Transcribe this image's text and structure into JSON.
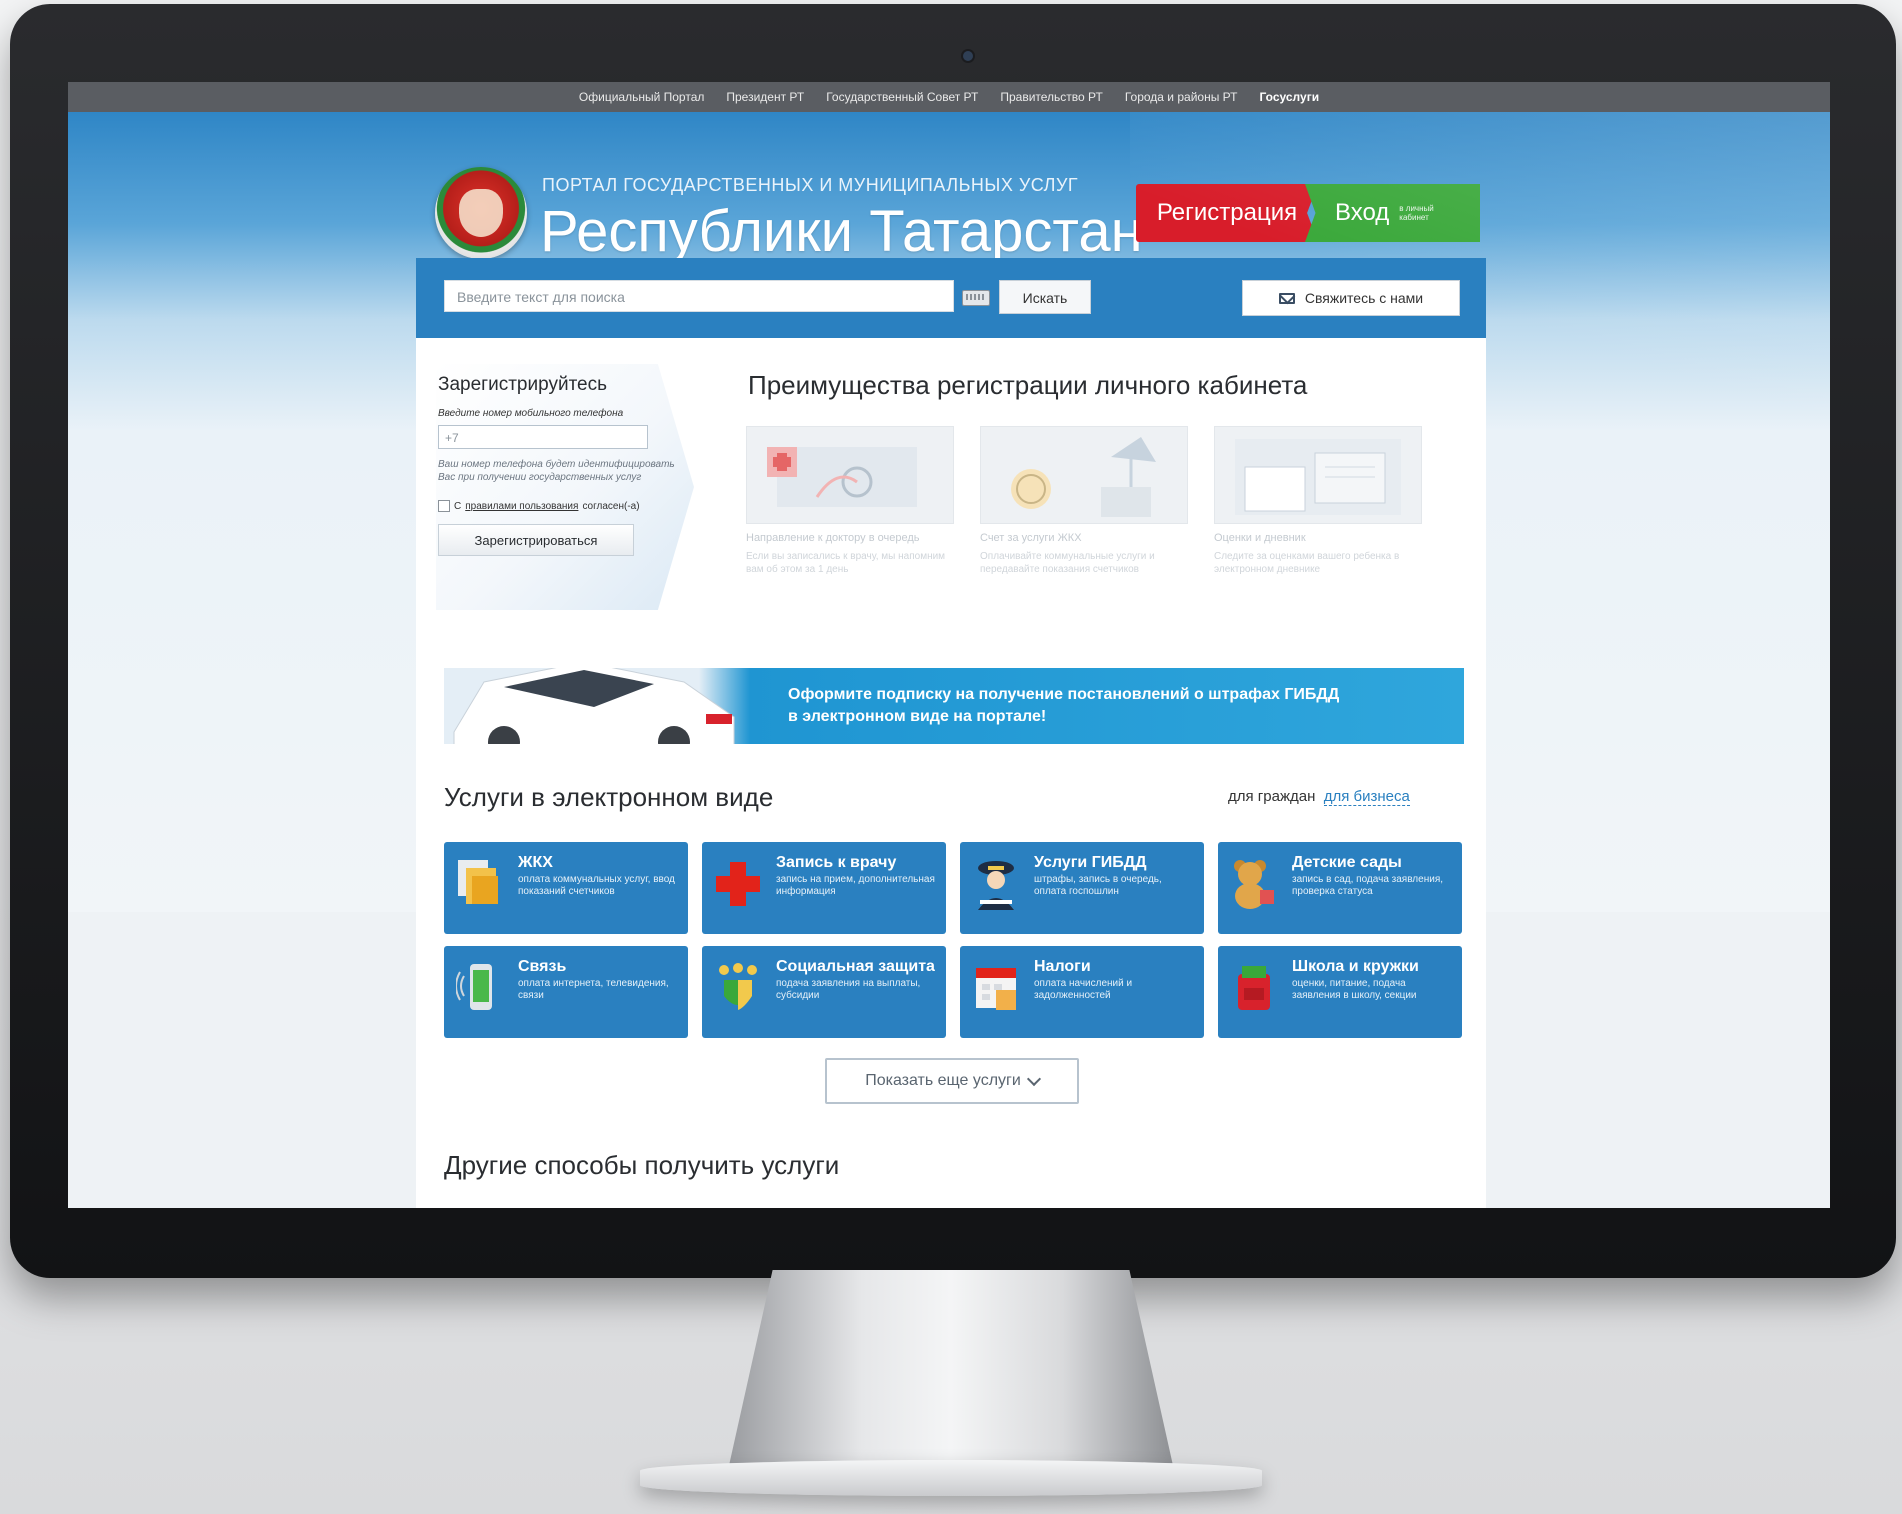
{
  "topnav": {
    "items": [
      "Официальный Портал",
      "Президент РТ",
      "Государственный Совет РТ",
      "Правительство РТ",
      "Города и районы РТ",
      "Госуслуги"
    ]
  },
  "header": {
    "subtitle": "ПОРТАЛ ГОСУДАРСТВЕННЫХ И МУНИЦИПАЛЬНЫХ УСЛУГ",
    "title": "Республики Татарстан",
    "register_label": "Регистрация",
    "login_label": "Вход",
    "login_sublabel": "в личный кабинет"
  },
  "search": {
    "placeholder": "Введите текст для поиска",
    "button_label": "Искать",
    "contact_label": "Свяжитесь с нами"
  },
  "register": {
    "title": "Зарегистрируйтесь",
    "phone_label": "Введите номер мобильного телефона",
    "phone_value": "+7",
    "note": "Ваш номер телефона будет идентифицировать Вас при получении государственных услуг",
    "agree_prefix": "С",
    "agree_link": "правилами пользования",
    "agree_suffix": "согласен(-а)",
    "button_label": "Зарегистрироваться"
  },
  "advantages": {
    "title": "Преимущества регистрации личного кабинета",
    "cards": [
      {
        "caption": "Направление к доктору в очередь",
        "desc": "Если вы записались к врачу, мы напомним вам об этом за 1 день"
      },
      {
        "caption": "Счет за услуги ЖКХ",
        "desc": "Оплачивайте коммунальные услуги и передавайте показания счетчиков"
      },
      {
        "caption": "Оценки и дневник",
        "desc": "Следите за оценками вашего ребенка в электронном дневнике"
      }
    ]
  },
  "banner": {
    "line1": "Оформите подписку на получение постановлений о штрафах ГИБДД",
    "line2": "в электронном виде на портале!"
  },
  "services": {
    "title": "Услуги в электронном виде",
    "for_citizens": "для граждан",
    "for_business": "для бизнеса",
    "items": [
      {
        "name": "ЖКХ",
        "desc": "оплата коммунальных услуг, ввод показаний счетчиков",
        "icon": "documents-icon"
      },
      {
        "name": "Запись к врачу",
        "desc": "запись на прием, дополнительная информация",
        "icon": "medical-cross-icon"
      },
      {
        "name": "Услуги ГИБДД",
        "desc": "штрафы, запись в очередь, оплата госпошлин",
        "icon": "police-officer-icon"
      },
      {
        "name": "Детские сады",
        "desc": "запись в сад, подача заявления, проверка статуса",
        "icon": "teddy-bear-icon"
      },
      {
        "name": "Связь",
        "desc": "оплата интернета, телевидения, связи",
        "icon": "mobile-phone-icon"
      },
      {
        "name": "Социальная защита",
        "desc": "подача заявления на выплаты, субсидии",
        "icon": "family-shield-icon"
      },
      {
        "name": "Налоги",
        "desc": "оплата начислений и задолженностей",
        "icon": "calendar-icon"
      },
      {
        "name": "Школа и кружки",
        "desc": "оценки, питание, подача заявления в школу, секции",
        "icon": "school-bag-icon"
      }
    ],
    "more_label": "Показать еще услуги"
  },
  "other": {
    "title": "Другие способы получить услуги"
  },
  "colors": {
    "brand_blue": "#2a80c0",
    "register_red": "#d81d2a",
    "login_green": "#3aa83a",
    "topnav_gray": "#5a5d62"
  }
}
